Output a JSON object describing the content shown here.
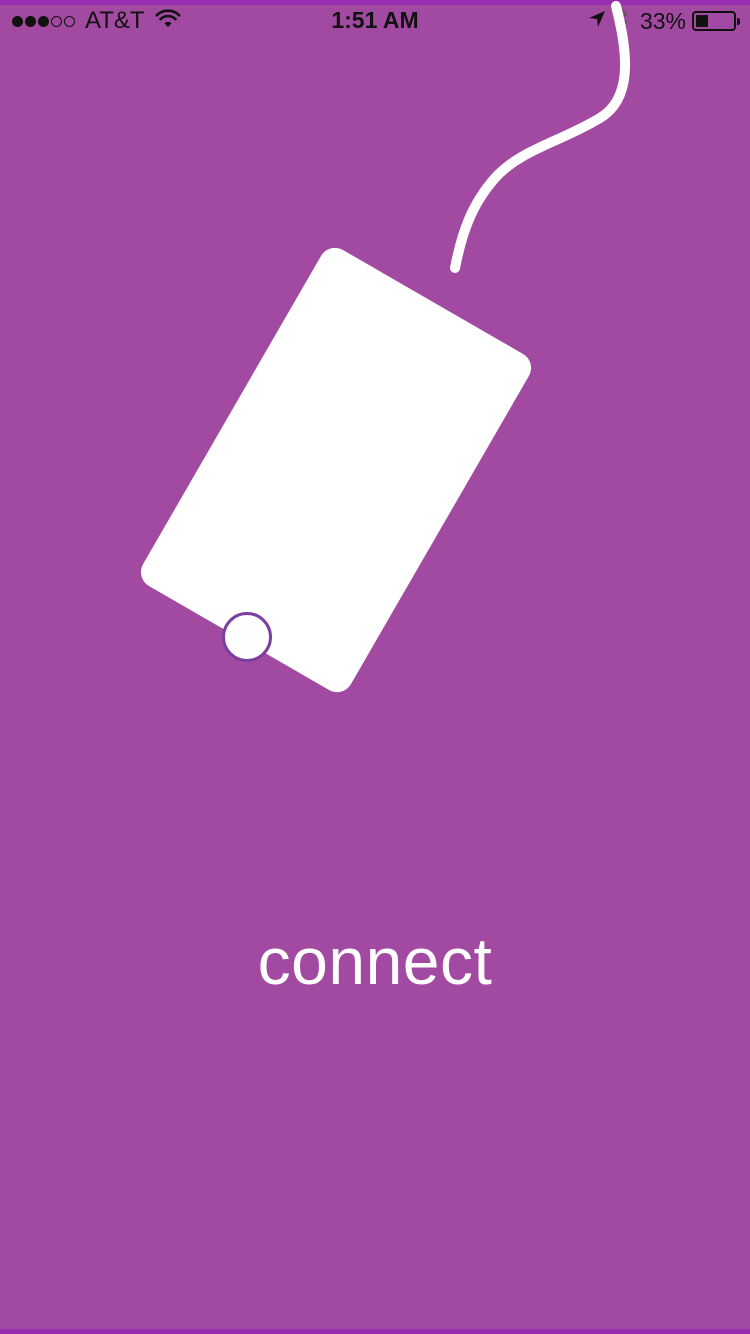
{
  "status_bar": {
    "signal_bars_filled": 3,
    "signal_bars_total": 5,
    "carrier": "AT&T",
    "wifi_icon": "wifi-icon",
    "time": "1:51 AM",
    "location_icon": "location-arrow-icon",
    "bluetooth_icon": "bluetooth-icon",
    "battery_percent": "33%",
    "battery_level": 0.33
  },
  "illustration": {
    "icon": "phone-with-cable-icon",
    "phone_color": "#ffffff",
    "home_button_color": "#7a3ea0"
  },
  "main": {
    "label": "connect"
  },
  "theme": {
    "background": "#a24aa1",
    "edge": "#9a2db0",
    "text": "#ffffff"
  }
}
